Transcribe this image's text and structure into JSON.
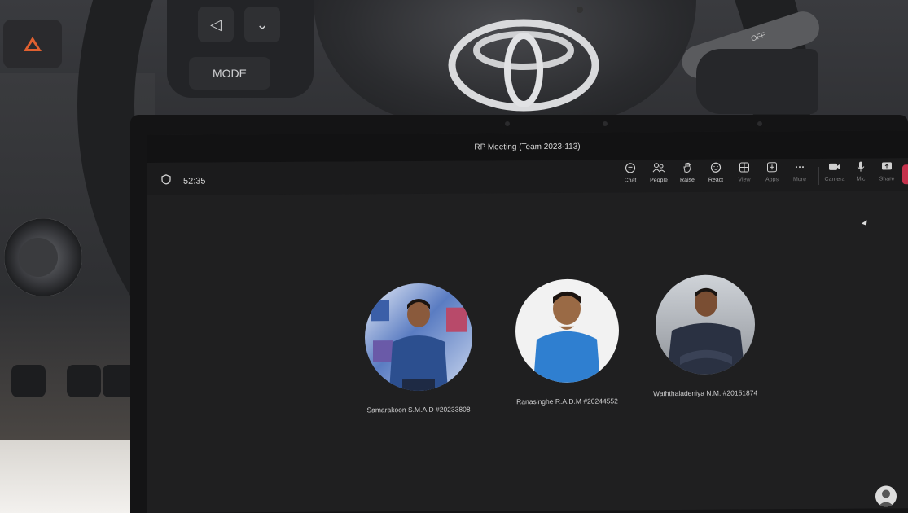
{
  "car": {
    "mode_button_label": "MODE",
    "stalk_label": "OFF"
  },
  "meeting": {
    "title": "RP Meeting (Team 2023-113)",
    "timer": "52:35",
    "toolbar": [
      {
        "label": "Chat",
        "icon": "chat-icon"
      },
      {
        "label": "People",
        "icon": "people-icon"
      },
      {
        "label": "Raise",
        "icon": "raise-hand-icon"
      },
      {
        "label": "React",
        "icon": "react-icon"
      },
      {
        "label": "View",
        "icon": "view-icon"
      },
      {
        "label": "Apps",
        "icon": "apps-icon"
      },
      {
        "label": "More",
        "icon": "more-icon"
      },
      {
        "label": "Camera",
        "icon": "camera-icon"
      },
      {
        "label": "Mic",
        "icon": "mic-icon"
      },
      {
        "label": "Share",
        "icon": "share-icon"
      }
    ],
    "participants": [
      {
        "name": "Samarakoon S.M.A.D #20233808",
        "avatar_bg": "#5a7cc2",
        "shirt": "#2c4f8f"
      },
      {
        "name": "Ranasinghe R.A.D.M #20244552",
        "avatar_bg": "#f2f2f2",
        "shirt": "#2f7fd0"
      },
      {
        "name": "Waththaladeniya N.M. #20151874",
        "avatar_bg": "#b8bcc2",
        "shirt": "#2a3142"
      }
    ]
  },
  "colors": {
    "leave_red": "#c4314b",
    "screen_bg": "#1f1f20"
  }
}
